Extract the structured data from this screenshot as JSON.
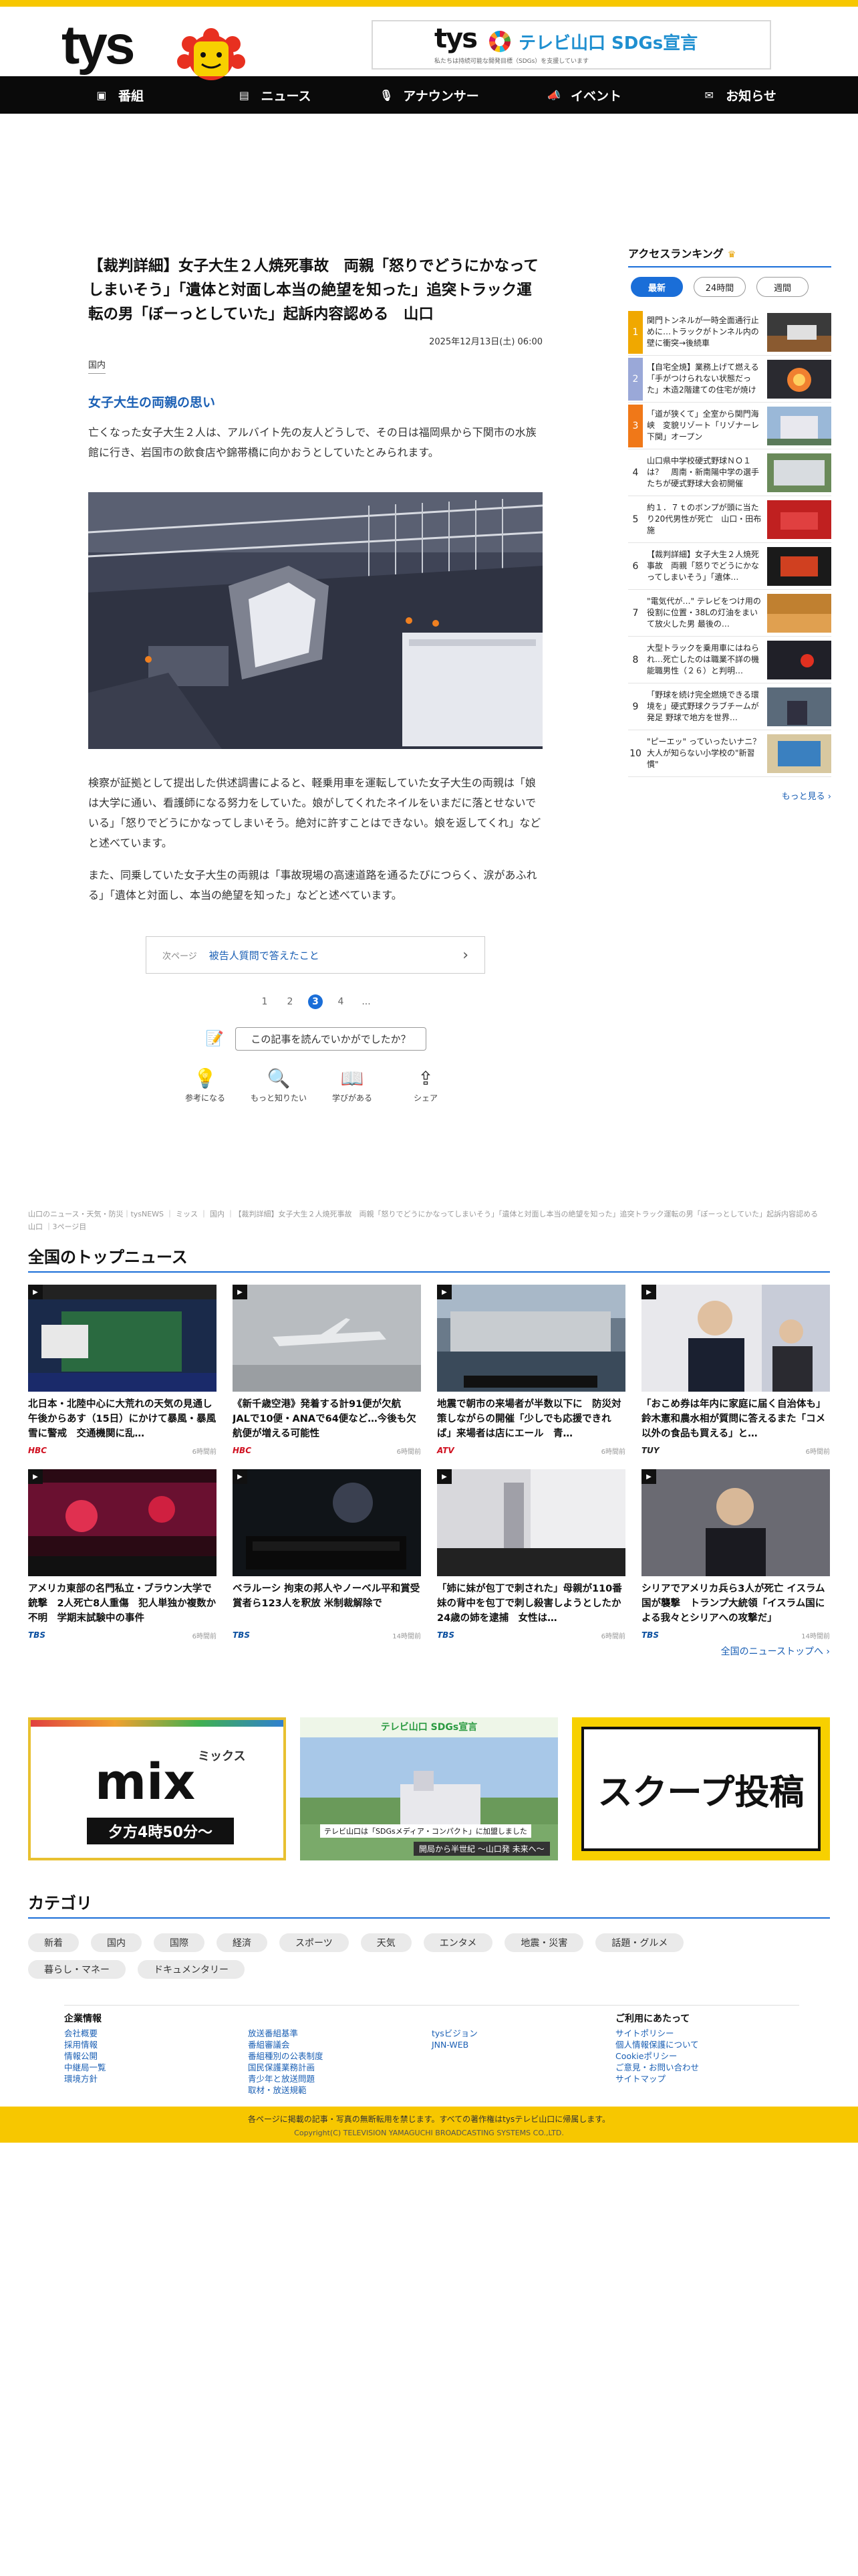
{
  "header": {
    "logo": "tys",
    "sdgs_logo": "tys",
    "sdgs_title": "テレビ山口 SDGs宣言",
    "sdgs_sub": "私たちは持続可能な開発目標（SDGs）を支援しています"
  },
  "nav": [
    {
      "label": "番組",
      "icon": "tv-icon"
    },
    {
      "label": "ニュース",
      "icon": "news-icon"
    },
    {
      "label": "アナウンサー",
      "icon": "microphone-icon"
    },
    {
      "label": "イベント",
      "icon": "megaphone-icon"
    },
    {
      "label": "お知らせ",
      "icon": "mail-icon"
    }
  ],
  "article": {
    "title": "【裁判詳細】女子大生２人焼死事故　両親「怒りでどうにかなってしまいそう」「遺体と対面し本当の絶望を知った」追突トラック運転の男「ぼーっとしていた」起訴内容認める　山口",
    "date": "2025年12月13日(土) 06:00",
    "category": "国内",
    "subheading": "女子大生の両親の思い",
    "p1": "亡くなった女子大生２人は、アルバイト先の友人どうしで、その日は福岡県から下関市の水族館に行き、岩国市の飲食店や錦帯橋に向かおうとしていたとみられます。",
    "p2": "検察が証拠として提出した供述調書によると、軽乗用車を運転していた女子大生の両親は「娘は大学に通い、看護師になる努力をしていた。娘がしてくれたネイルをいまだに落とせないでいる」「怒りでどうにかなってしまいそう。絶対に許すことはできない。娘を返してくれ」などと述べています。",
    "p3": "また、同乗していた女子大生の両親は「事故現場の高速道路を通るたびにつらく、涙があふれる」「遺体と対面し、本当の絶望を知った」などと述べています。",
    "next_label": "次ページ",
    "next_title": "被告人質問で答えたこと",
    "pages": [
      "1",
      "2",
      "3",
      "4",
      "..."
    ],
    "current_page": "3",
    "feedback_question": "この記事を読んでいかがでしたか？",
    "reactions": [
      "参考になる",
      "もっと知りたい",
      "学びがある",
      "シェア"
    ]
  },
  "ranking": {
    "title": "アクセスランキング",
    "tabs": [
      "最新",
      "24時間",
      "週間"
    ],
    "active_tab": "最新",
    "items": [
      {
        "no": "1",
        "text": "関門トンネルが一時全面通行止めに…トラックがトンネル内の壁に衝突→後続車"
      },
      {
        "no": "2",
        "text": "【自宅全焼】業務上げて燃える「手がつけられない状態だった」木造2階建ての住宅が焼ける"
      },
      {
        "no": "3",
        "text": "「道が狭くて」全室から関門海峡　変貌リゾート「リゾナーレ下関」オープン"
      },
      {
        "no": "4",
        "text": "山口県中学校硬式野球ＮＯ１は？　周南・新南陽中学の選手たちが硬式野球大会初開催"
      },
      {
        "no": "5",
        "text": "約１．７ｔのボンプが頭に当たり20代男性が死亡　山口・田布施"
      },
      {
        "no": "6",
        "text": "【裁判詳細】女子大生２人焼死事故　両親「怒りでどうにかなってしまいそう」「遺体…"
      },
      {
        "no": "7",
        "text": "\"電気代が…\" テレビをつけ用の役割に位置・38Lの灯油をまいて放火した男 最後の…"
      },
      {
        "no": "8",
        "text": "大型トラックを乗用車にはねられ…死亡したのは職業不詳の機能職男性（２６）と判明…"
      },
      {
        "no": "9",
        "text": "「野球を続け完全燃焼できる環境を」硬式野球クラブチームが発足 野球で地方を世界…"
      },
      {
        "no": "10",
        "text": "\"ピーエッ\" っていったいナニ？大人が知らない小学校の\"新習慣\""
      }
    ],
    "more": "もっと見る ›"
  },
  "breadcrumb": "山口のニュース・天気・防災｜tysNEWS ｜ ミッス ｜ 国内 ｜【裁判詳細】女子大生２人焼死事故　両親「怒りでどうにかなってしまいそう」「遺体と対面し本当の絶望を知った」追突トラック運転の男「ぼーっとしていた」起訴内容認める　山口 ｜3ページ目",
  "topnews": {
    "title": "全国のトップニュース",
    "items": [
      {
        "title": "北日本・北陸中心に大荒れの天気の見通し　午後からあす（15日）にかけて暴風・暴風雪に警戒　交通機関に乱…",
        "src": "HBC",
        "time": "6時間前",
        "src_color": "#d01020"
      },
      {
        "title": "《新千歳空港》発着する計91便が欠航　JALで10便・ANAで64便など…今後も欠航便が増える可能性",
        "src": "HBC",
        "time": "6時間前",
        "src_color": "#d01020"
      },
      {
        "title": "地震で朝市の来場者が半数以下に　防災対策しながらの開催「少しでも応援できれば」来場者は店にエール　青…",
        "src": "ATV",
        "time": "6時間前",
        "src_color": "#d01020"
      },
      {
        "title": "「おこめ券は年内に家庭に届く自治体も」鈴木憲和農水相が質問に答えるまた「コメ以外の食品も買える」と…",
        "src": "TUY",
        "time": "6時間前",
        "src_color": "#222222"
      },
      {
        "title": "アメリカ東部の名門私立・ブラウン大学で銃撃　2人死亡8人重傷　犯人単独か複数か不明　学期末試験中の事件",
        "src": "TBS",
        "time": "6時間前",
        "src_color": "#0a4fa0"
      },
      {
        "title": "ベラルーシ 拘束の邦人やノーベル平和賞受賞者ら123人を釈放 米制裁解除で",
        "src": "TBS",
        "time": "14時間前",
        "src_color": "#0a4fa0"
      },
      {
        "title": "「姉に妹が包丁で刺された」母親が110番　妹の背中を包丁で刺し殺害しようとしたか　24歳の姉を逮捕　女性は…",
        "src": "TBS",
        "time": "6時間前",
        "src_color": "#0a4fa0"
      },
      {
        "title": "シリアでアメリカ兵ら3人が死亡 イスラム国が襲撃　トランプ大統領「イスラム国による我々とシリアへの攻撃だ」",
        "src": "TBS",
        "time": "14時間前",
        "src_color": "#0a4fa0"
      }
    ],
    "more": "全国のニューストップへ ›"
  },
  "banners": {
    "mix_title": "mix",
    "mix_sub": "ミックス",
    "mix_time": "夕方4時50分～",
    "sdgs_head": "テレビ山口 SDGs宣言",
    "sdgs_caption": "テレビ山口は「SDGsメディア・コンパクト」に加盟しました",
    "sdgs_caption2": "開局から半世紀 ～山口発 未来へ～",
    "scoop": "スクープ投稿"
  },
  "category": {
    "title": "カテゴリ",
    "items": [
      "新着",
      "国内",
      "国際",
      "経済",
      "スポーツ",
      "天気",
      "エンタメ",
      "地震・災害",
      "話題・グルメ",
      "暮らし・マネー",
      "ドキュメンタリー"
    ]
  },
  "footer_links": [
    {
      "head": "企業情報",
      "links": [
        "会社概要",
        "採用情報",
        "情報公開",
        "中継局一覧",
        "環境方針"
      ]
    },
    {
      "head": "",
      "links": [
        "放送番組基準",
        "番組審議会",
        "番組種別の公表制度",
        "国民保護業務計画",
        "青少年と放送問題",
        "取材・放送規範"
      ]
    },
    {
      "head": "",
      "links": [
        "tysビジョン",
        "JNN-WEB"
      ]
    },
    {
      "head": "ご利用にあたって",
      "links": [
        "サイトポリシー",
        "個人情報保護について",
        "Cookieポリシー",
        "ご意見・お問い合わせ",
        "サイトマップ"
      ]
    }
  ],
  "footer": {
    "notice": "各ページに掲載の記事・写真の無断転用を禁じます。すべての著作権はtysテレビ山口に帰属します。",
    "copyright": "Copyright(C) TELEVISION YAMAGUCHI BROADCASTING SYSTEMS CO.,LTD."
  }
}
